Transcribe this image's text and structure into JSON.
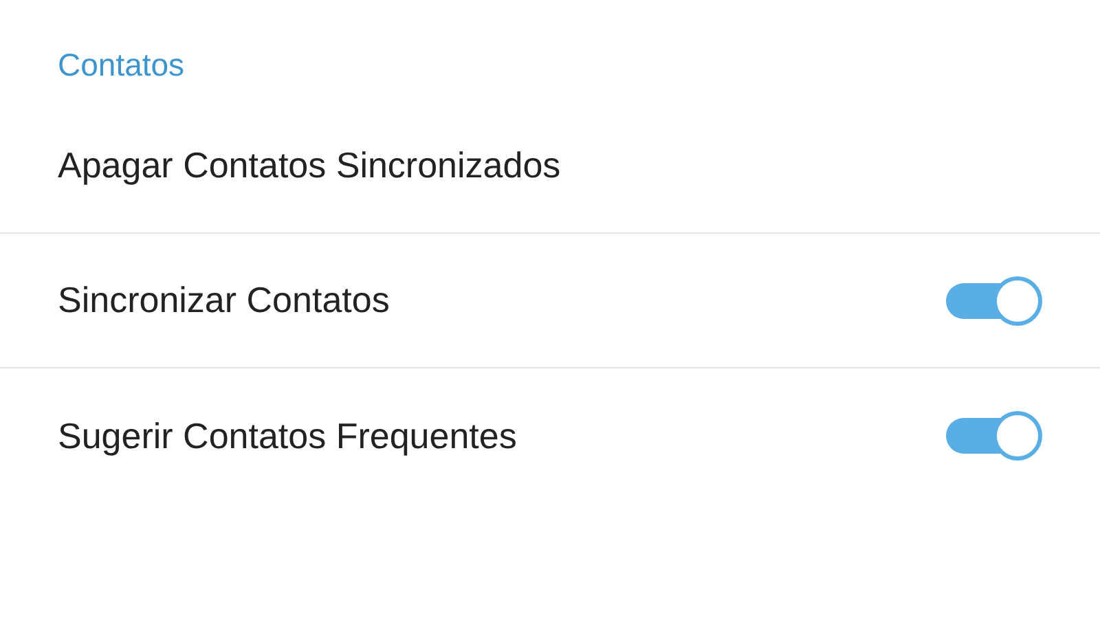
{
  "section": {
    "title": "Contatos"
  },
  "items": [
    {
      "kind": "action",
      "label": "Apagar Contatos Sincronizados"
    },
    {
      "kind": "toggle",
      "label": "Sincronizar Contatos",
      "on": true
    },
    {
      "kind": "toggle",
      "label": "Sugerir Contatos Frequentes",
      "on": true
    }
  ]
}
